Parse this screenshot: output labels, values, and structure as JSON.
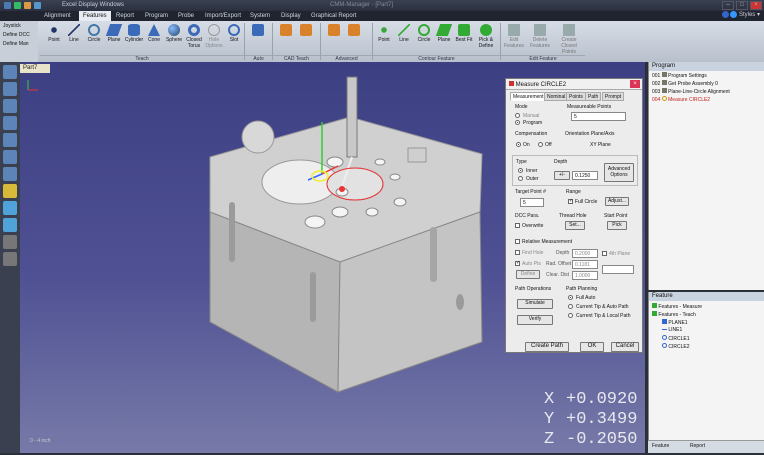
{
  "app": {
    "title": "Excel Display Windows",
    "window_title": "CMM-Manager - [Part7]"
  },
  "menu": {
    "items": [
      "Alignment",
      "Features",
      "Report",
      "Program",
      "Probe",
      "Import/Export",
      "System",
      "Display",
      "Graphical Report"
    ],
    "active": "Features",
    "styles": "Styles"
  },
  "left_panel": {
    "items": [
      "Joystick",
      "Define DCC",
      "Define Man"
    ]
  },
  "ribbon": {
    "teach_buttons": [
      "Point",
      "Line",
      "Circle",
      "Plane",
      "Cylinder",
      "Cone",
      "Sphere",
      "Closed Torus",
      "Hole Options",
      "Slot"
    ],
    "contour_buttons": [
      "Point",
      "Line",
      "Circle",
      "Plane",
      "Best Fit",
      "Pick & Define"
    ],
    "edit_buttons": [
      "Edit Features",
      "Delete Features",
      "Create Closed Points"
    ],
    "groups": [
      "Teach",
      "Auto Feature",
      "CAD Teach",
      "Advanced",
      "Contour Feature",
      "Edit Feature"
    ]
  },
  "viewport": {
    "tab": "Part7",
    "scale": "0 - 4 inch"
  },
  "coords": {
    "x_label": "X",
    "x": "+0.0920",
    "y_label": "Y",
    "y": "+0.3499",
    "z_label": "Z",
    "z": "-0.2050"
  },
  "dialog": {
    "title": "Measure CIRCLE2",
    "tabs": [
      "Measurement",
      "Nominal",
      "Points",
      "Path",
      "Prompt"
    ],
    "mode_label": "Mode",
    "mode_options": [
      "Manual",
      "Program"
    ],
    "measurable_points_label": "Measureable Points",
    "measurable_points": "5",
    "compensation_label": "Compensation",
    "comp_on": "On",
    "comp_off": "Off",
    "orientation_label": "Orientation Plane/Axis",
    "orientation_value": "XY Plane",
    "type_label": "Type",
    "type_options": [
      "Inner",
      "Outer"
    ],
    "depth_label": "Depth",
    "depth_sign": "+/-",
    "depth_value": "0.1250",
    "advanced_btn": "Advanced Options",
    "target_label": "Target Point #",
    "target_value": "5",
    "range_label": "Range",
    "full_circle": "Full Circle",
    "adjust_btn": "Adjust...",
    "dcc_label": "DCC Para.",
    "overwrite": "Overwrite",
    "thread_label": "Thread Hole",
    "set_btn": "Set...",
    "start_label": "Start Point",
    "pick_btn": "Pick",
    "relative": "Relative Measurement",
    "find_hole": "Find Hole",
    "auto_pts": "Auto Pts",
    "define_btn": "Define",
    "rel_depth_label": "Depth",
    "rel_depth": "0.2000",
    "rad_offset_label": "Rad. Offset",
    "rad_offset": "0.1181",
    "clear_dist_label": "Clear. Dist",
    "clear_dist": "1.0000",
    "fourth_plane": "4th Plane",
    "path_ops_label": "Path Operations",
    "simulate_btn": "Simulate",
    "verify_btn": "Verify",
    "path_planning_label": "Path Planning",
    "path_options": [
      "Full Auto",
      "Current Tip & Auto Path",
      "Current Tip & Local Path"
    ],
    "create_path_btn": "Create Path",
    "ok_btn": "OK",
    "cancel_btn": "Cancel"
  },
  "program": {
    "header": "Program",
    "rows": [
      {
        "num": "001",
        "text": "Program Settings"
      },
      {
        "num": "002",
        "text": "Get Probe Assembly 0"
      },
      {
        "num": "003",
        "text": "Plane-Line-Circle Alignment"
      },
      {
        "num": "004",
        "text": "Measure CIRCLE2"
      }
    ]
  },
  "feature": {
    "header": "Feature",
    "rows": [
      "Features - Measure",
      "Features - Teach",
      "PLANE1",
      "LINE1",
      "CIRCLE1",
      "CIRCLE2"
    ],
    "tabs": [
      "Feature",
      "Report"
    ]
  },
  "colors": {
    "accent": "#4a7ab0",
    "viewport_top": "#3c3f82",
    "viewport_bottom": "#777aa8",
    "selected": "#c02020"
  }
}
